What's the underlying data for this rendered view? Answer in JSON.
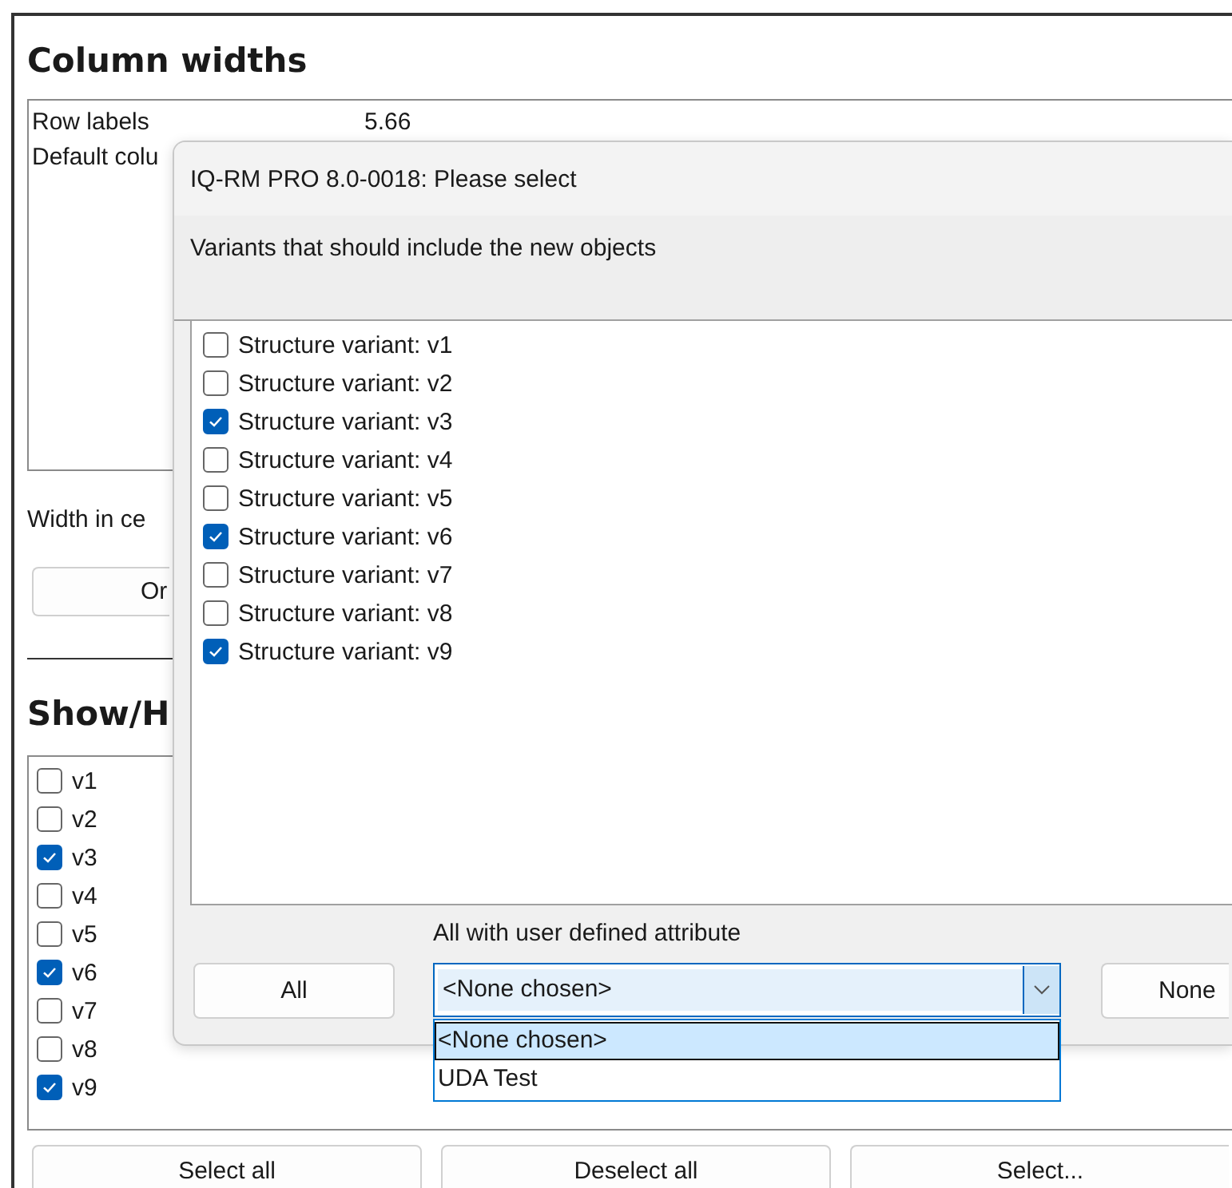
{
  "panel": {
    "column_widths": {
      "heading": "Column widths",
      "rows": [
        {
          "label": "Row labels",
          "value": "5.66"
        },
        {
          "label": "Default colu"
        }
      ]
    },
    "width_label": "Width in ce",
    "option_button": "Or",
    "show_hide": {
      "heading": "Show/H",
      "items": [
        {
          "label": "v1",
          "checked": false
        },
        {
          "label": "v2",
          "checked": false
        },
        {
          "label": "v3",
          "checked": true
        },
        {
          "label": "v4",
          "checked": false
        },
        {
          "label": "v5",
          "checked": false
        },
        {
          "label": "v6",
          "checked": true
        },
        {
          "label": "v7",
          "checked": false
        },
        {
          "label": "v8",
          "checked": false
        },
        {
          "label": "v9",
          "checked": true
        }
      ]
    },
    "buttons": [
      "Select all",
      "Deselect all",
      "Select..."
    ]
  },
  "dialog": {
    "title": "IQ-RM PRO 8.0-0018: Please select",
    "caption": "Variants that should include the new objects",
    "variants": [
      {
        "label": "Structure variant: v1",
        "checked": false
      },
      {
        "label": "Structure variant: v2",
        "checked": false
      },
      {
        "label": "Structure variant: v3",
        "checked": true
      },
      {
        "label": "Structure variant: v4",
        "checked": false
      },
      {
        "label": "Structure variant: v5",
        "checked": false
      },
      {
        "label": "Structure variant: v6",
        "checked": true
      },
      {
        "label": "Structure variant: v7",
        "checked": false
      },
      {
        "label": "Structure variant: v8",
        "checked": false
      },
      {
        "label": "Structure variant: v9",
        "checked": true
      }
    ],
    "attribute_label": "All with user defined attribute",
    "all_button": "All",
    "none_button": "None",
    "combo": {
      "value": "<None chosen>",
      "expanded": true,
      "items": [
        {
          "label": "<None chosen>",
          "selected": true
        },
        {
          "label": "UDA Test",
          "selected": false
        }
      ]
    }
  }
}
